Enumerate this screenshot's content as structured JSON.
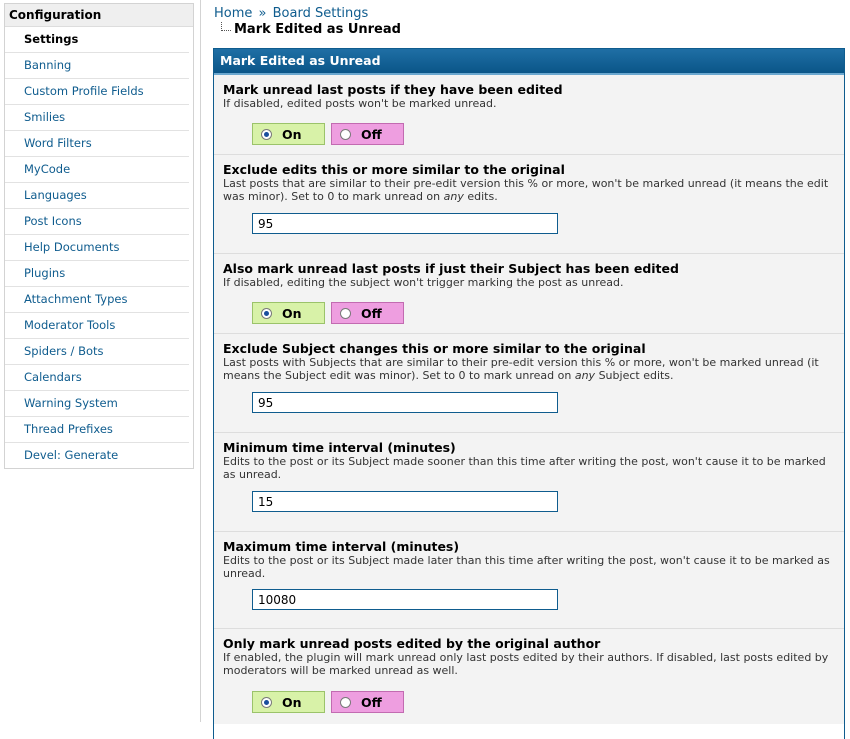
{
  "sidebar": {
    "heading": "Configuration",
    "items": [
      {
        "label": "Settings",
        "active": true
      },
      {
        "label": "Banning"
      },
      {
        "label": "Custom Profile Fields"
      },
      {
        "label": "Smilies"
      },
      {
        "label": "Word Filters"
      },
      {
        "label": "MyCode"
      },
      {
        "label": "Languages"
      },
      {
        "label": "Post Icons"
      },
      {
        "label": "Help Documents"
      },
      {
        "label": "Plugins"
      },
      {
        "label": "Attachment Types"
      },
      {
        "label": "Moderator Tools"
      },
      {
        "label": "Spiders / Bots"
      },
      {
        "label": "Calendars"
      },
      {
        "label": "Warning System"
      },
      {
        "label": "Thread Prefixes"
      },
      {
        "label": "Devel: Generate"
      }
    ]
  },
  "breadcrumb": {
    "home": "Home",
    "separator": "»",
    "section": "Board Settings",
    "current": "Mark Edited as Unread"
  },
  "panel": {
    "header": "Mark Edited as Unread",
    "yes_label": "On",
    "no_label": "Off",
    "settings": [
      {
        "title": "Mark unread last posts if they have been edited",
        "desc": "If disabled, edited posts won't be marked unread.",
        "type": "yesno",
        "value": "On"
      },
      {
        "title": "Exclude edits this or more similar to the original",
        "desc_pre": "Last posts that are similar to their pre-edit version this % or more, won't be marked unread (it means the edit was minor). Set to 0 to mark unread on ",
        "desc_em": "any",
        "desc_post": " edits.",
        "type": "text",
        "value": "95"
      },
      {
        "title": "Also mark unread last posts if just their Subject has been edited",
        "desc": "If disabled, editing the subject won't trigger marking the post as unread.",
        "type": "yesno",
        "value": "On"
      },
      {
        "title": "Exclude Subject changes this or more similar to the original",
        "desc_pre": "Last posts with Subjects that are similar to their pre-edit version this % or more, won't be marked unread (it means the Subject edit was minor). Set to 0 to mark unread on ",
        "desc_em": "any",
        "desc_post": " Subject edits.",
        "type": "text",
        "value": "95"
      },
      {
        "title": "Minimum time interval (minutes)",
        "desc": "Edits to the post or its Subject made sooner than this time after writing the post, won't cause it to be marked as unread.",
        "type": "text",
        "value": "15"
      },
      {
        "title": "Maximum time interval (minutes)",
        "desc": "Edits to the post or its Subject made later than this time after writing the post, won't cause it to be marked as unread.",
        "type": "text",
        "value": "10080"
      },
      {
        "title": "Only mark unread posts edited by the original author",
        "desc": "If enabled, the plugin will mark unread only last posts edited by their authors. If disabled, last posts edited by moderators will be marked unread as well.",
        "type": "yesno",
        "value": "On"
      }
    ]
  }
}
